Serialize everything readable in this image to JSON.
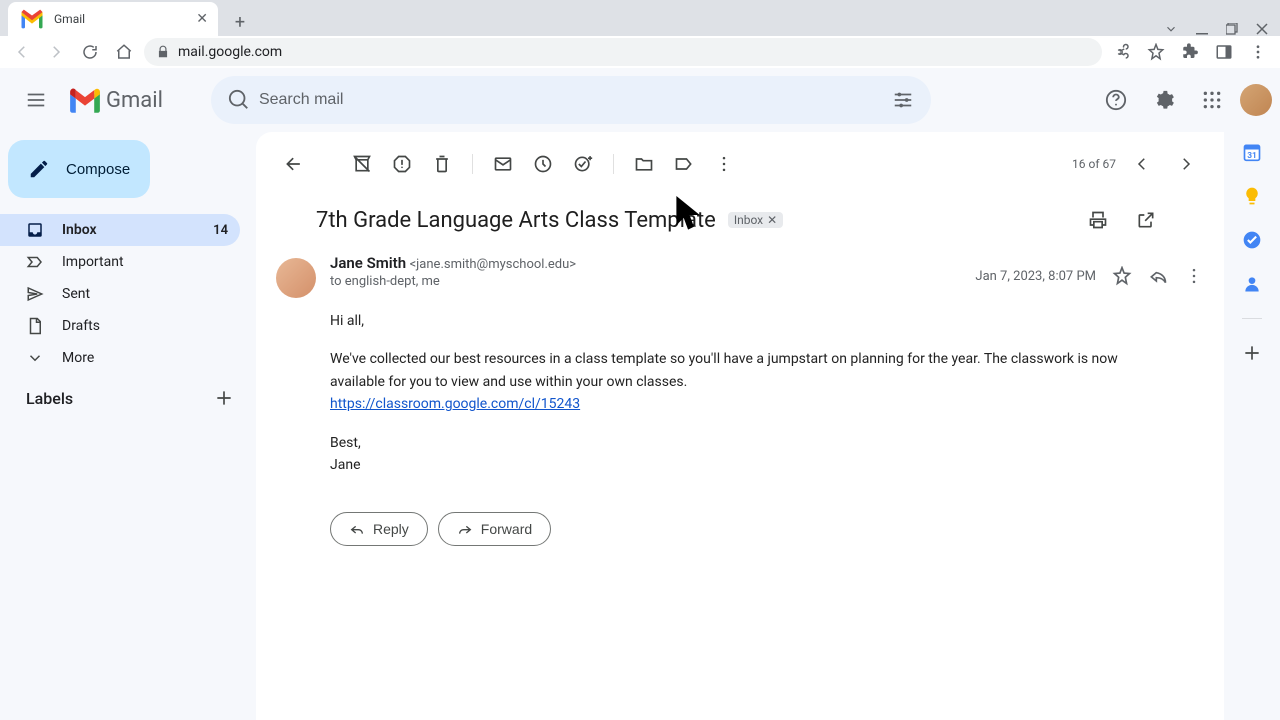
{
  "browser": {
    "tab_title": "Gmail",
    "url": "mail.google.com"
  },
  "app_name": "Gmail",
  "search": {
    "placeholder": "Search mail"
  },
  "compose_label": "Compose",
  "sidebar": {
    "items": [
      {
        "label": "Inbox",
        "count": "14",
        "icon": "inbox"
      },
      {
        "label": "Important",
        "icon": "important"
      },
      {
        "label": "Sent",
        "icon": "sent"
      },
      {
        "label": "Drafts",
        "icon": "drafts"
      },
      {
        "label": "More",
        "icon": "more"
      }
    ],
    "labels_header": "Labels"
  },
  "pager": "16 of 67",
  "email": {
    "subject": "7th Grade Language Arts Class Template",
    "chip": "Inbox",
    "sender_name": "Jane Smith",
    "sender_email": "<jane.smith@myschool.edu>",
    "recipients": "to english-dept, me",
    "timestamp": "Jan 7, 2023, 8:07 PM",
    "greeting": "Hi all,",
    "body": "We've collected our best resources in a class template so you'll have a jumpstart on planning for the year. The classwork is now available for you to view and use within your own classes.",
    "link": "https://classroom.google.com/cl/15243",
    "signoff": "Best,",
    "signature": "Jane",
    "reply_label": "Reply",
    "forward_label": "Forward"
  }
}
